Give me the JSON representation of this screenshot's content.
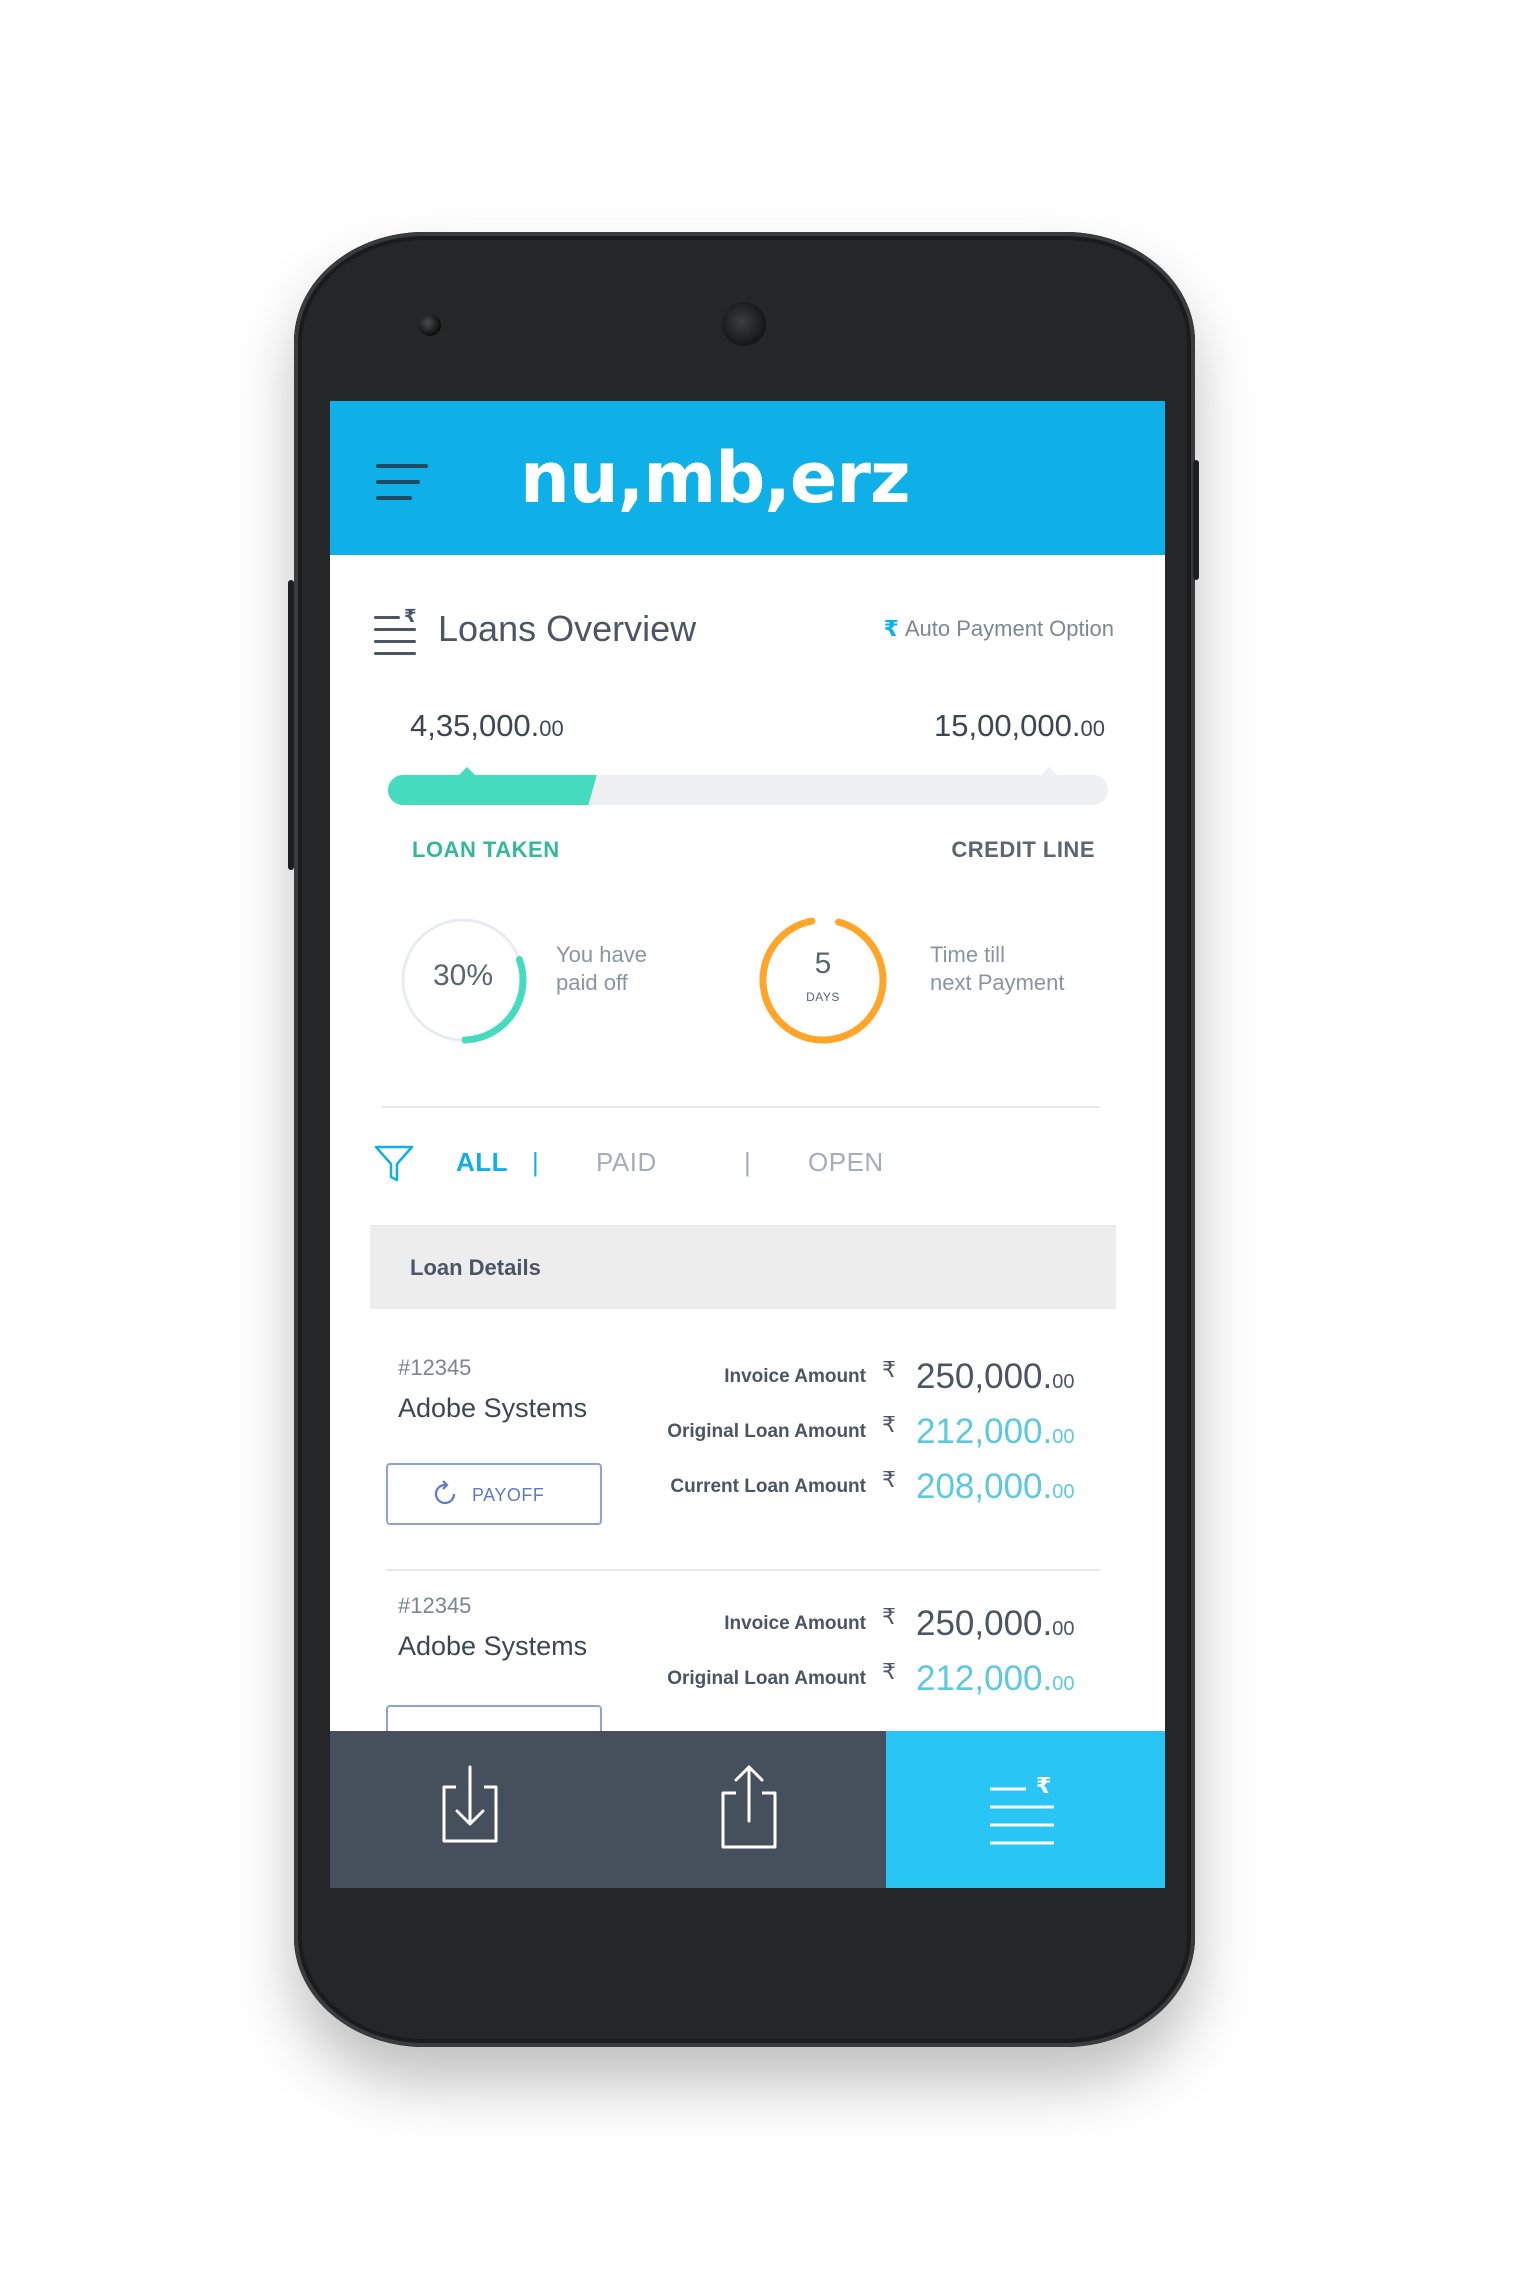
{
  "app": {
    "title": "nu,mb,erz",
    "accent": "#0fb0e8"
  },
  "overview": {
    "title": "Loans Overview",
    "auto_payment_symbol": "₹",
    "auto_payment_label": "Auto Payment Option",
    "loan_taken_amount": "4,35,000.",
    "loan_taken_decimals": "00",
    "credit_line_amount": "15,00,000.",
    "credit_line_decimals": "00",
    "loan_taken_label": "LOAN TAKEN",
    "credit_line_label": "CREDIT LINE",
    "loan_progress_fraction": 0.29,
    "paid_off_value": "30%",
    "paid_off_fraction": 0.3,
    "paid_off_caption_line1": "You have",
    "paid_off_caption_line2": "paid off",
    "days_value": "5",
    "days_unit": "DAYS",
    "days_caption_line1": "Time till",
    "days_caption_line2": "next Payment"
  },
  "filters": {
    "all": "ALL",
    "separator": "|",
    "paid": "PAID",
    "open": "OPEN",
    "active": "ALL"
  },
  "loan_details": {
    "header": "Loan Details",
    "rupee_symbol": "₹",
    "items": [
      {
        "id": "#12345",
        "company": "Adobe Systems",
        "payoff_label": "PAYOFF",
        "invoice_label": "Invoice Amount",
        "invoice_value": "250,000.",
        "invoice_decimals": "00",
        "original_label": "Original Loan Amount",
        "original_value": "212,000.",
        "original_decimals": "00",
        "current_label": "Current Loan Amount",
        "current_value": "208,000.",
        "current_decimals": "00"
      },
      {
        "id": "#12345",
        "company": "Adobe Systems",
        "invoice_label": "Invoice Amount",
        "invoice_value": "250,000.",
        "invoice_decimals": "00",
        "original_label": "Original Loan Amount",
        "original_value": "212,000.",
        "original_decimals": "00"
      }
    ]
  },
  "bottom_nav": {
    "items": [
      {
        "icon": "download-icon"
      },
      {
        "icon": "share-icon"
      },
      {
        "icon": "loan-list-icon",
        "active": true
      }
    ]
  }
}
